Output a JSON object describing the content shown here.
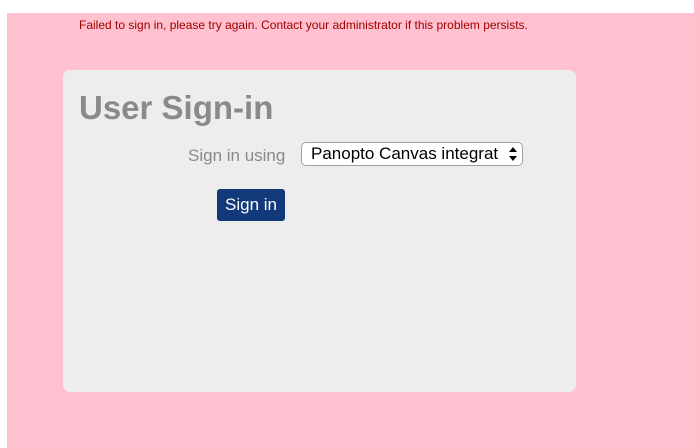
{
  "error": {
    "message": "Failed to sign in, please try again. Contact your administrator if this problem persists."
  },
  "signin_panel": {
    "title": "User Sign-in",
    "provider_label": "Sign in using",
    "provider_select": {
      "selected": "Panopto Canvas integrat",
      "icon": "select-updown-arrows-icon"
    },
    "signin_button_label": "Sign in"
  },
  "colors": {
    "page_background": "#ffc0cf",
    "panel_background": "#ededed",
    "error_text": "#a00000",
    "muted_text": "#8a8a8a",
    "button_background": "#123a7a",
    "button_text": "#ffffff"
  }
}
